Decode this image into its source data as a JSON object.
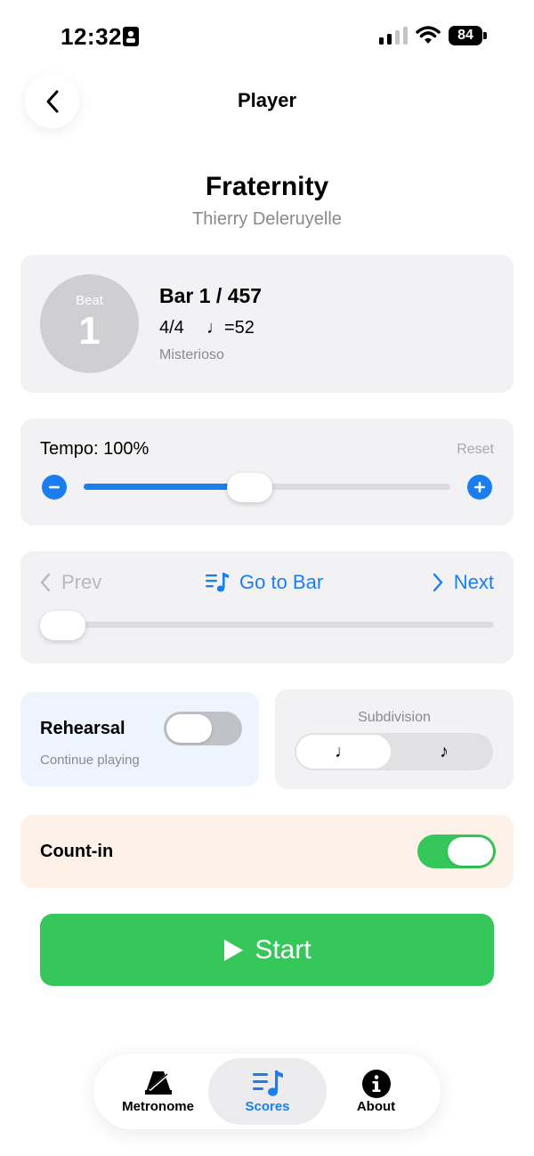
{
  "status_bar": {
    "time": "12:32",
    "battery": "84"
  },
  "nav": {
    "title": "Player",
    "back_icon": "chevron-left-icon"
  },
  "song": {
    "title": "Fraternity",
    "composer": "Thierry Deleruyelle"
  },
  "beat_card": {
    "beat_label": "Beat",
    "beat_number": "1",
    "bar_count": "Bar 1 / 457",
    "time_signature": "4/4",
    "tempo_marking": "♩=52",
    "expression": "Misterioso"
  },
  "tempo": {
    "label": "Tempo: 100%",
    "reset_label": "Reset",
    "decrease_icon": "minus-circle-icon",
    "increase_icon": "plus-circle-icon",
    "slider_value_fraction": 0.44,
    "accent": "#1b7ef0"
  },
  "navigation": {
    "prev_label": "Prev",
    "goto_label": "Go to Bar",
    "next_label": "Next",
    "goto_icon": "music-list-icon",
    "bar_slider_value_fraction": 0.0
  },
  "rehearsal": {
    "label": "Rehearsal",
    "subtitle": "Continue playing",
    "enabled": false
  },
  "subdivision": {
    "label": "Subdivision",
    "options": [
      "♩",
      "♪"
    ],
    "selected": "♩"
  },
  "count_in": {
    "label": "Count-in",
    "enabled": true
  },
  "start": {
    "label": "Start",
    "icon": "play-icon",
    "color": "#35c759"
  },
  "tabs": [
    {
      "label": "Metronome",
      "icon": "metronome-icon",
      "active": false
    },
    {
      "label": "Scores",
      "icon": "music-list-icon",
      "active": true
    },
    {
      "label": "About",
      "icon": "info-icon",
      "active": false
    }
  ]
}
